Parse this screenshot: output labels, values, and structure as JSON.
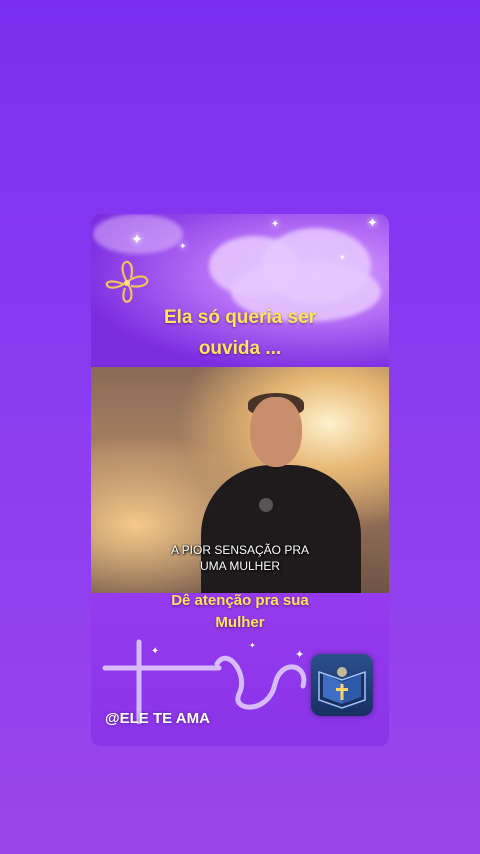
{
  "post": {
    "headline_line1": "Ela só queria ser",
    "headline_line2": "ouvida ...",
    "video_subtitle_line1": "A PIOR SENSAÇÃO PRA",
    "video_subtitle_line2": "UMA MULHER",
    "caption_line1": "Dê atenção pra sua",
    "caption_line2": "Mulher",
    "handle": "@ELE TE AMA"
  },
  "icons": {
    "flower": "flower-icon",
    "bible_logo": "bible-cross-icon",
    "cross_heart": "cross-heart-drawing"
  },
  "colors": {
    "background": "#8b3cf0",
    "headline": "#ffe55a",
    "subtitle": "#ffffff"
  }
}
